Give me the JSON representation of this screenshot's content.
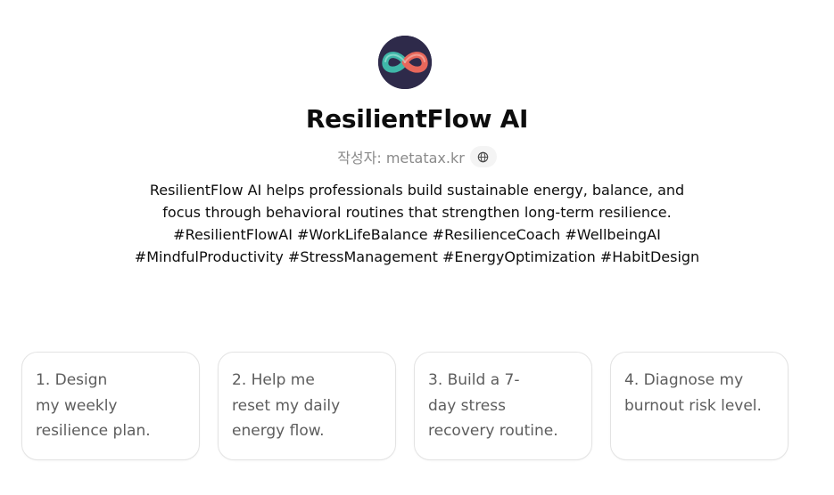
{
  "gpt": {
    "name": "ResilientFlow AI",
    "author_label": "작성자: metatax.kr",
    "description": "ResilientFlow AI helps professionals build sustainable energy, balance, and focus through behavioral routines that strengthen long-term resilience. #ResilientFlowAI #WorkLifeBalance #ResilienceCoach #WellbeingAI #MindfulProductivity #StressManagement #EnergyOptimization #HabitDesign"
  },
  "icons": {
    "avatar": "infinity-logo-icon",
    "website": "globe-icon"
  },
  "colors": {
    "avatar_bg": "#2e2a4a",
    "logo_teal": "#3fb7a8",
    "logo_coral": "#e8675b"
  },
  "starters": [
    {
      "label": "1. Design\nmy weekly\nresilience plan."
    },
    {
      "label": "2. Help me\nreset my daily\nenergy flow."
    },
    {
      "label": "3. Build a 7-\nday stress\nrecovery routine."
    },
    {
      "label": "4. Diagnose my\nburnout risk level."
    }
  ]
}
